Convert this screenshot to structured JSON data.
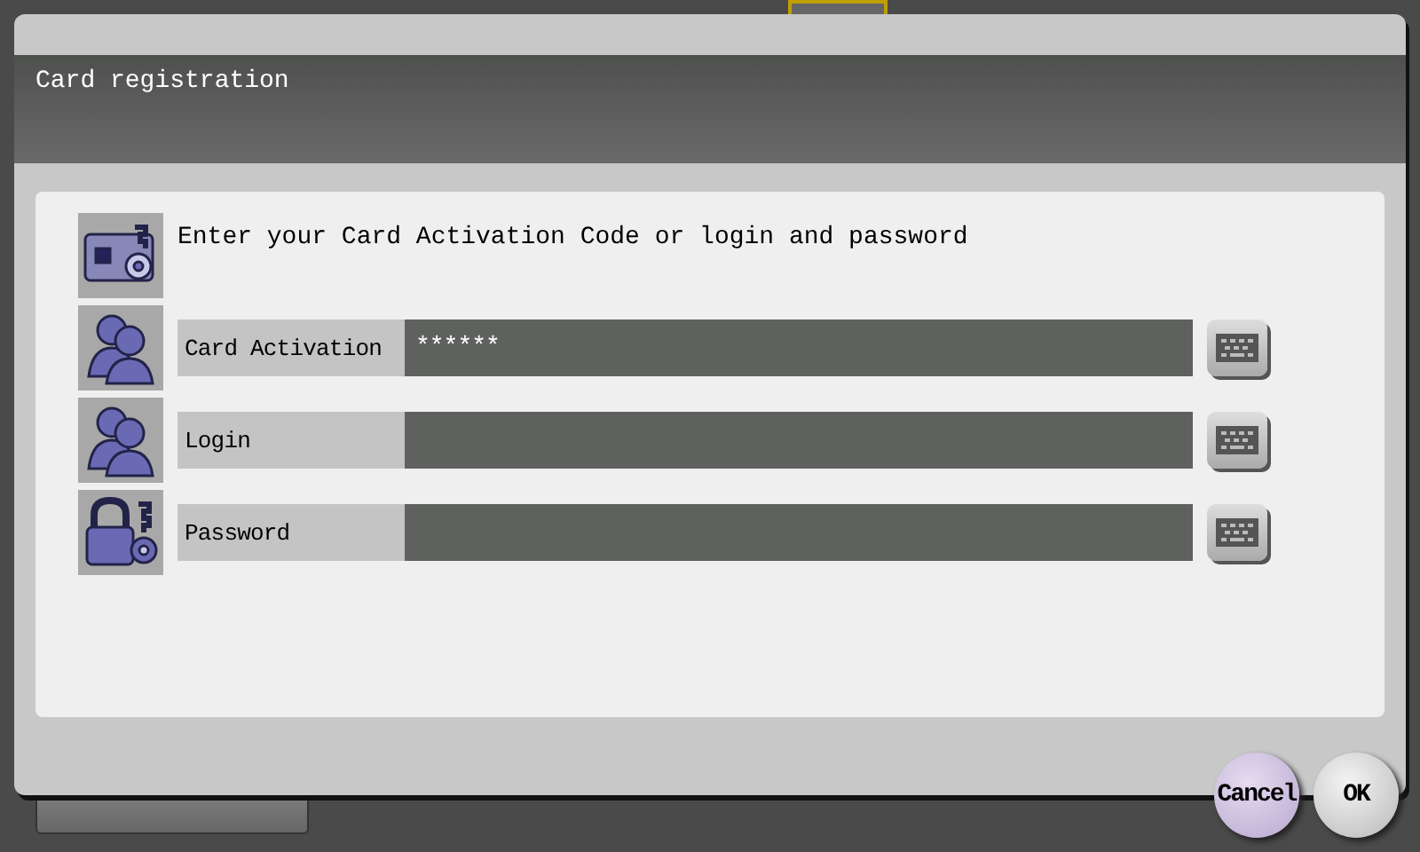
{
  "dialog": {
    "title": "Card registration",
    "instruction": "Enter your Card Activation Code or login and password",
    "fields": [
      {
        "label": "Card Activation",
        "value": "******"
      },
      {
        "label": "Login"
      },
      {
        "label": "Password"
      }
    ],
    "buttons": [
      "Cancel",
      "OK"
    ]
  }
}
